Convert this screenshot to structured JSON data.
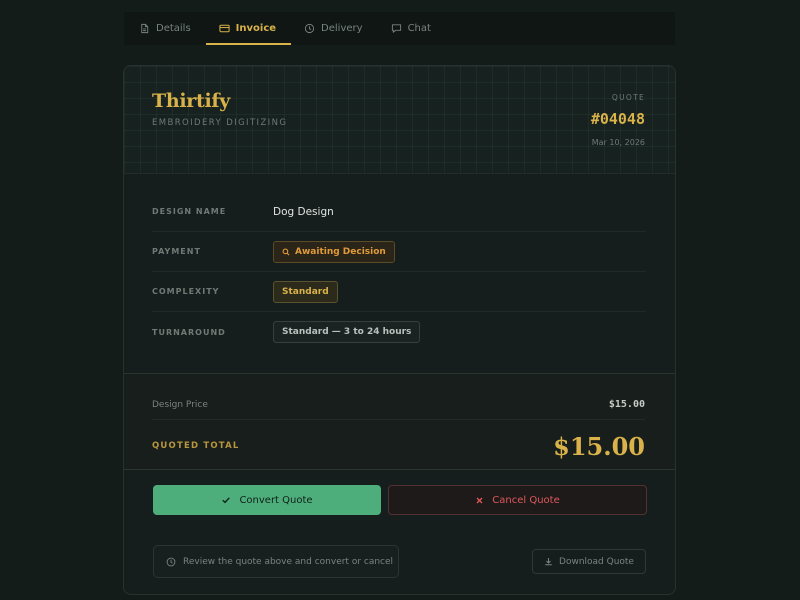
{
  "tabs": [
    {
      "label": "Details",
      "icon": "document-icon",
      "active": false
    },
    {
      "label": "Invoice",
      "icon": "card-icon",
      "active": true
    },
    {
      "label": "Delivery",
      "icon": "clock-icon",
      "active": false
    },
    {
      "label": "Chat",
      "icon": "chat-icon",
      "active": false
    }
  ],
  "header": {
    "brand": "Thirtify",
    "subtitle": "EMBROIDERY DIGITIZING",
    "quote_label": "QUOTE",
    "quote_number": "#04048",
    "date": "Mar 10, 2026"
  },
  "details": {
    "design_name_label": "DESIGN NAME",
    "design_name": "Dog Design",
    "payment_label": "PAYMENT",
    "payment_status": "Awaiting Decision",
    "complexity_label": "COMPLEXITY",
    "complexity": "Standard",
    "turnaround_label": "TURNAROUND",
    "turnaround": "Standard — 3 to 24 hours"
  },
  "pricing": {
    "design_price_label": "Design Price",
    "design_price": "$15.00",
    "total_label": "QUOTED TOTAL",
    "total": "$15.00"
  },
  "actions": {
    "convert_label": "Convert Quote",
    "cancel_label": "Cancel Quote",
    "hint": "Review the quote above and convert or cancel",
    "download_label": "Download Quote"
  },
  "colors": {
    "accent_gold": "#d9b24a",
    "success_green": "#4dae7b",
    "danger_red": "#e0575a",
    "warning_orange": "#e09a3a"
  }
}
